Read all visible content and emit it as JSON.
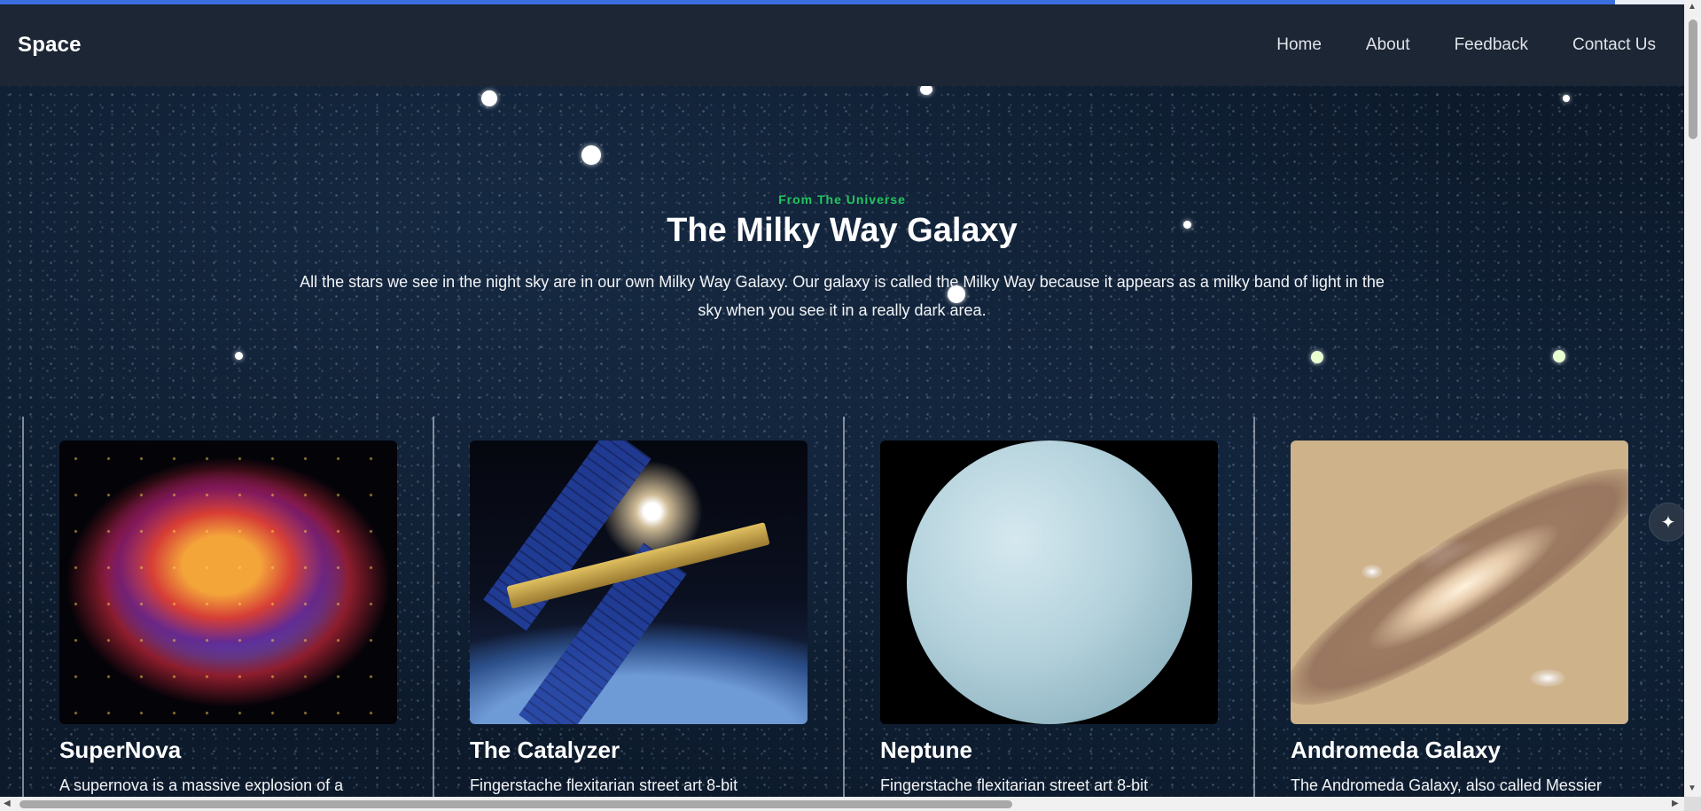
{
  "nav": {
    "brand": "Space",
    "links": [
      "Home",
      "About",
      "Feedback",
      "Contact Us"
    ]
  },
  "hero": {
    "eyebrow": "From The Universe",
    "title": "The Milky Way Galaxy",
    "description": "All the stars we see in the night sky are in our own Milky Way Galaxy. Our galaxy is called the Milky Way because it appears as a milky band of light in the sky when you see it in a really dark area."
  },
  "cards": [
    {
      "title": "SuperNova",
      "text": "A supernova is a massive explosion of a",
      "image_icon": "supernova-image"
    },
    {
      "title": "The Catalyzer",
      "text": "Fingerstache flexitarian street art 8-bit",
      "image_icon": "satellite-image"
    },
    {
      "title": "Neptune",
      "text": "Fingerstache flexitarian street art 8-bit",
      "image_icon": "neptune-image"
    },
    {
      "title": "Andromeda Galaxy",
      "text": "The Andromeda Galaxy, also called Messier",
      "image_icon": "andromeda-image"
    }
  ],
  "side_button": {
    "icon": "sparkle-icon",
    "glyph": "✦"
  },
  "colors": {
    "accent_progress": "#3b6fe0",
    "navbar_bg": "#1d2634",
    "eyebrow_green": "#22c55e"
  }
}
